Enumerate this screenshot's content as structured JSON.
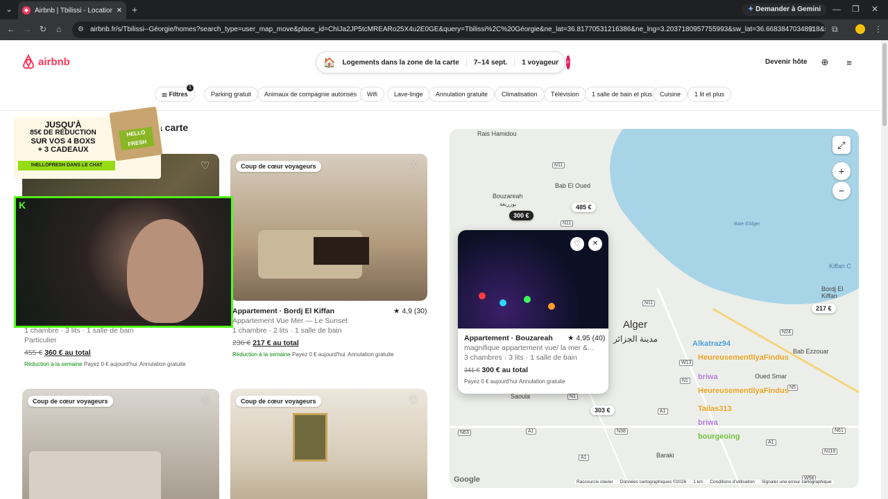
{
  "browser": {
    "tab_title": "Airbnb | Tbilissi - Locations de v",
    "url": "airbnb.fr/s/Tbilissi--Géorgie/homes?search_type=user_map_move&place_id=ChIJa2JP5tcMREARo25X4u2E0GE&query=Tbilissi%2C%20Géorgie&ne_lat=36.81770531216386&ne_lng=3.2037180957755993&sw_lat=36.66838470348918&sw_lng=2.98...",
    "gemini_label": "Demander à Gemini"
  },
  "header": {
    "logo": "airbnb",
    "search_area": "Logements dans la zone de la carte",
    "dates": "7–14 sept.",
    "guests": "1 voyageur",
    "host_link": "Devenir hôte"
  },
  "filters": {
    "filters_label": "Filtres",
    "filters_count": "1",
    "chips": [
      "Parking gratuit",
      "Animaux de compagnie autorisés",
      "Wifi",
      "Lave-linge",
      "Annulation gratuite",
      "Climatisation",
      "Télévision",
      "1 salle de bain et plus",
      "Cuisine",
      "1 lit et plus"
    ]
  },
  "results_heading_visible": "a carte",
  "promo": {
    "line1": "JUSQU'À",
    "line2": "85€ DE RÉDUCTION",
    "line3": "SUR VOS 4 BOXS",
    "line4": "+ 3 CADEAUX",
    "line5": "!HELLOFRESH DANS LE CHAT",
    "box_text": "HELLO FRESH"
  },
  "listings": [
    {
      "details": "1 chambre · 3 lits · 1 salle de bain",
      "host": "Particulier",
      "old_price": "455 €",
      "price": "360 € au total",
      "tags": [
        "Réduction à la semaine",
        "Payez 0 € aujourd'hui",
        "Annulation gratuite"
      ]
    },
    {
      "badge": "Coup de cœur voyageurs",
      "title": "Appartement · Bordj El Kiffan",
      "rating": "★ 4,9 (30)",
      "subtitle": "Appartement Vue Mer — Le Sunset",
      "details": "1 chambre · 2 lits · 1 salle de bain",
      "old_price": "236 €",
      "price": "217 € au total",
      "tags": [
        "Réduction à la semaine",
        "Payez 0 € aujourd'hui",
        "Annulation gratuite"
      ]
    },
    {
      "badge": "Coup de cœur voyageurs"
    },
    {
      "badge": "Coup de cœur voyageurs"
    }
  ],
  "map": {
    "labels": {
      "rais_hamidou": "Rais Hamidou",
      "bouzareah": "Bouzareah",
      "bouzareah_ar": "بوزريعة",
      "bab_el_oued": "Bab El Oued",
      "baie": "Baie d'Alger",
      "alger": "Alger",
      "alger_ar": "مدينة الجزائر",
      "bordj": "Bordj El Kiffan",
      "bab_ezzouar": "Bab Ezzouar",
      "oued_smar": "Oued Smar",
      "saoula": "Saoula",
      "baraki": "Baraki",
      "kiffan": "Kiffan C"
    },
    "pins": [
      "300 €",
      "485 €",
      "217 €",
      "303 €"
    ],
    "footer": [
      "Raccourcis clavier",
      "Données cartographiques ©2026",
      "1 km",
      "Conditions d'utilisation",
      "Signaler une erreur cartographique"
    ],
    "google": "Google",
    "popup": {
      "title": "Appartement · Bouzareah",
      "rating": "★ 4,95 (40)",
      "subtitle": "magnifique appartement vue/ la mer &...",
      "details": "3 chambres · 3 lits · 1 salle de bain",
      "old_price": "341 €",
      "price": "300 € au total",
      "tags": [
        "Payez 0 € aujourd'hui",
        "Annulation gratuite"
      ]
    },
    "roads": [
      "N11",
      "N11",
      "N11",
      "N24",
      "N5",
      "W13",
      "N1",
      "A1",
      "N38",
      "N63",
      "A1",
      "A1",
      "N61",
      "N118",
      "A1",
      "W58",
      "N1"
    ],
    "chat_names": [
      "Alkatraz94",
      "HeureusementIlyaFindus",
      "briwa",
      "HeureusementIlyaFindus",
      "Tailas313",
      "briwa",
      "bourgeoing"
    ]
  }
}
